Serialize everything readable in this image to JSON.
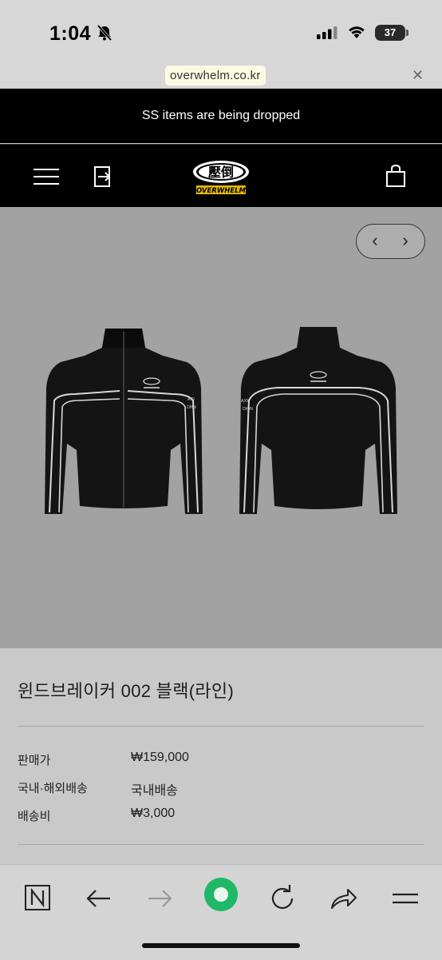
{
  "status_bar": {
    "time": "1:04",
    "battery": "37",
    "icons": [
      "bell-slash-icon",
      "cellular-signal-icon",
      "wifi-icon",
      "battery-icon"
    ]
  },
  "browser": {
    "url": "overwhelm.co.kr",
    "close_icon": "close-icon"
  },
  "announcement": {
    "text": "SS items are being dropped"
  },
  "nav": {
    "menu_icon": "hamburger-menu-icon",
    "login_icon": "login-icon",
    "logo_text": "OVERWHELM",
    "logo_hanja": "壓倒",
    "cart_icon": "shopping-bag-icon"
  },
  "gallery": {
    "prev_icon": "chevron-left-icon",
    "next_icon": "chevron-right-icon",
    "image_alt": "black windbreaker with white piping, front and back views"
  },
  "product": {
    "title": "윈드브레이커 002 블랙(라인)",
    "rows": [
      {
        "label": "판매가",
        "value": "₩159,000"
      },
      {
        "label": "국내·해외배송",
        "value": "국내배송"
      },
      {
        "label": "배송비",
        "value": "₩3,000"
      }
    ]
  },
  "toolbar": {
    "icons": [
      "notion-n-icon",
      "back-arrow-icon",
      "forward-arrow-icon",
      "home-circle-icon",
      "reload-icon",
      "share-icon",
      "menu-icon"
    ]
  },
  "colors": {
    "announce_bg": "#000000",
    "hero_bg": "#a2a2a2",
    "page_bg": "#c9c9c9",
    "accent_green": "#1fb866"
  }
}
